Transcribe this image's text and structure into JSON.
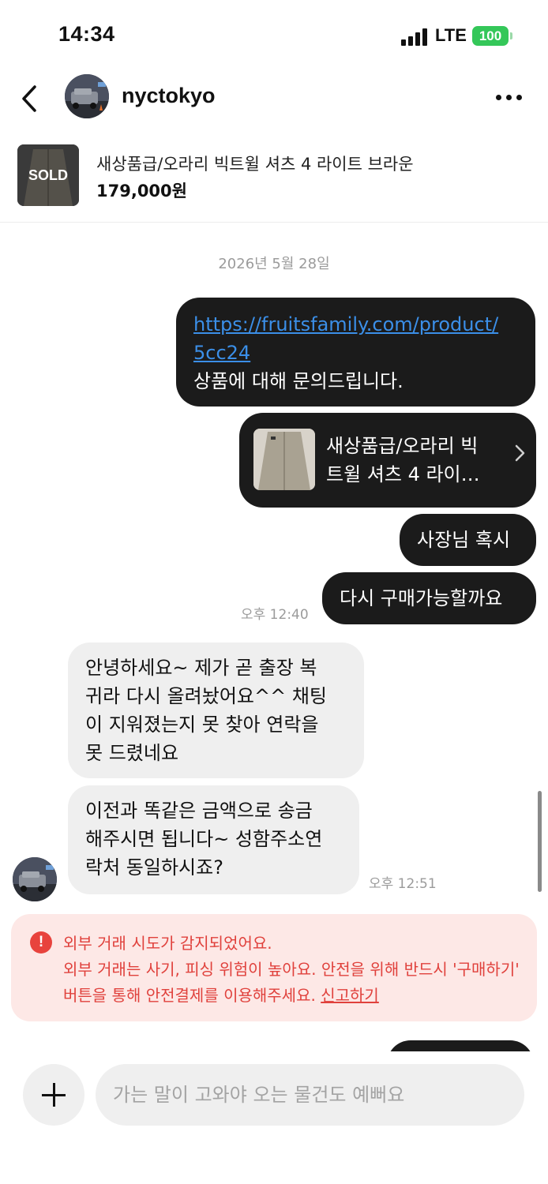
{
  "status_bar": {
    "time": "14:34",
    "network": "LTE",
    "battery": "100"
  },
  "header": {
    "username": "nyctokyo"
  },
  "product": {
    "sold_badge": "SOLD",
    "title": "새상품급/오라리 빅트윌 셔츠 4 라이트 브라운",
    "price": "179,000원"
  },
  "chat": {
    "date": "2026년 5월 28일",
    "messages": {
      "link_url": "https://fruitsfamily.com/product/5cc24",
      "link_line1": "https://fruitsfamily.com/product/",
      "link_line2": "5cc24",
      "inquiry": "상품에 대해 문의드립니다.",
      "card_line1": "새상품급/오라리 빅",
      "card_line2": "트윌 셔츠 4 라이…",
      "out3": "사장님 혹시",
      "out4": "다시 구매가능할까요",
      "out_time": "오후 12:40",
      "in1_line1": "안녕하세요~ 제가 곧 출장 복",
      "in1_line2": "귀라 다시 올려놨어요^^ 채팅",
      "in1_line3": "이 지워졌는지 못 찾아 연락을",
      "in1_line4": "못 드렸네요",
      "in2_line1": "이전과 똑같은 금액으로 송금",
      "in2_line2": "해주시면 됩니다~ 성함주소연",
      "in2_line3": "락처 동일하시죠?",
      "in_time": "오후 12:51"
    },
    "warning": {
      "icon": "!",
      "title": "외부 거래 시도가 감지되었어요.",
      "body": "외부 거래는 사기, 피싱 위험이 높아요. 안전을 위해 반드시 '구매하기' 버튼을 통해 안전결제를 이용해주세요.",
      "report_link": "신고하기"
    }
  },
  "composer": {
    "placeholder": "가는 말이 고와야 오는 물건도 예뻐요"
  },
  "icons": [
    "back-chevron-icon",
    "more-dots-icon",
    "chevron-right-icon",
    "plus-icon",
    "alert-icon"
  ],
  "colors": {
    "outgoing_bubble": "#1b1b1b",
    "incoming_bubble": "#efefef",
    "link": "#3b8fe8",
    "warning_text": "#e0413c",
    "warning_bg": "#fde8e6",
    "battery": "#34c759"
  }
}
